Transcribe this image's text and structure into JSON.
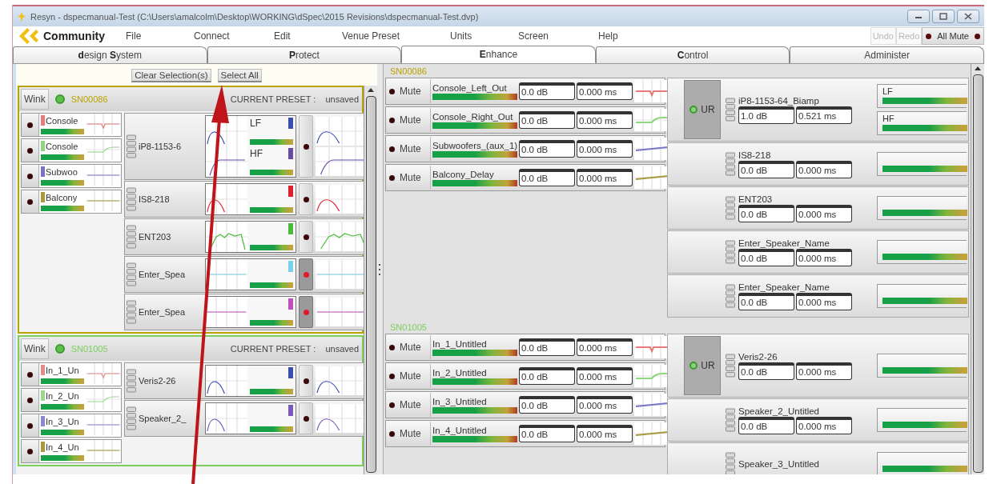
{
  "window": {
    "title": "Resyn - dspecmanual-Test (C:\\Users\\amalcolm\\Desktop\\WORKING\\dSpec\\2015 Revisions\\dspecmanual-Test.dvp)"
  },
  "menu": {
    "brand": "Community",
    "items": [
      "File",
      "Connect",
      "Edit",
      "Venue Preset",
      "Units",
      "Screen",
      "Help"
    ],
    "undo": {
      "label": "Undo",
      "disabled": true
    },
    "redo": {
      "label": "Redo",
      "disabled": true
    },
    "all_mute": "All Mute"
  },
  "tabs": [
    {
      "label": "**d**esign **S**ystem",
      "selected": false
    },
    {
      "label": "**P**rotect",
      "selected": false
    },
    {
      "label": "**E**nhance",
      "selected": true
    },
    {
      "label": "**C**ontrol",
      "selected": false
    },
    {
      "label": "Administer",
      "selected": false
    }
  ],
  "left_panel": {
    "clear_button": "Clear Selection(s)",
    "select_all_button": "Select All",
    "devices": [
      {
        "wink": "Wink",
        "serial": "SN00086",
        "color": "#b8a400",
        "preset_label": "CURRENT PRESET :",
        "preset_value": "unsaved",
        "inputs": [
          {
            "name": "Console",
            "color": "#e87a7a",
            "muted": false
          },
          {
            "name": "Console",
            "color": "#8fd47f",
            "muted": false
          },
          {
            "name": "Subwoo",
            "color": "#7a74c8",
            "muted": false
          },
          {
            "name": "Balcony",
            "color": "#a69a3a",
            "muted": false
          }
        ],
        "outputs": [
          {
            "name": "iP8-1153-6",
            "muted": false,
            "bands": [
              {
                "label": "LF",
                "color": "#3a4db0"
              },
              {
                "label": "HF",
                "color": "#6a4aa8"
              }
            ]
          },
          {
            "name": "IS8-218",
            "muted": false,
            "bands": [
              {
                "color": "#e02030"
              }
            ]
          },
          {
            "name": "ENT203",
            "muted": false,
            "bands": [
              {
                "color": "#4cba3c"
              }
            ]
          },
          {
            "name": "Enter_Spea",
            "muted": true,
            "bands": [
              {
                "color": "#7ad0e8"
              }
            ]
          },
          {
            "name": "Enter_Spea",
            "muted": true,
            "bands": [
              {
                "color": "#c050c0"
              }
            ]
          }
        ]
      },
      {
        "wink": "Wink",
        "serial": "SN01005",
        "color": "#7ccf5a",
        "preset_label": "CURRENT PRESET :",
        "preset_value": "unsaved",
        "inputs": [
          {
            "name": "In_1_Un",
            "color": "#e88a8a",
            "muted": false
          },
          {
            "name": "In_2_Un",
            "color": "#9ad88a",
            "muted": false
          },
          {
            "name": "In_3_Un",
            "color": "#8a86d8",
            "muted": false
          },
          {
            "name": "In_4_Un",
            "color": "#a69a3a",
            "muted": false
          }
        ],
        "outputs": [
          {
            "name": "Veris2-26",
            "muted": false,
            "bands": [
              {
                "color": "#3a4db0"
              }
            ]
          },
          {
            "name": "Speaker_2_",
            "muted": false,
            "bands": [
              {
                "color": "#7a5ab8"
              }
            ]
          }
        ]
      }
    ]
  },
  "right_panel": {
    "devices": [
      {
        "serial": "SN00086",
        "color": "#b8a400",
        "ur": "UR",
        "inputs": [
          {
            "mute": "Mute",
            "muted": false,
            "name": "Console_Left_Out",
            "gain": "0.0 dB",
            "delay": "0.000 ms",
            "color": "#e87a7a"
          },
          {
            "mute": "Mute",
            "muted": false,
            "name": "Console_Right_Out",
            "gain": "0.0 dB",
            "delay": "0.000 ms",
            "color": "#8fd47f"
          },
          {
            "mute": "Mute",
            "muted": false,
            "name": "Subwoofers_(aux_1)",
            "gain": "0.0 dB",
            "delay": "0.000 ms",
            "color": "#7a74c8"
          },
          {
            "mute": "Mute",
            "muted": false,
            "name": "Balcony_Delay",
            "gain": "0.0 dB",
            "delay": "0.000 ms",
            "color": "#a69a3a"
          }
        ],
        "outputs": [
          {
            "name": "iP8-1153-64_Biamp",
            "gain": "1.0 dB",
            "delay": "0.521 ms",
            "bands": [
              {
                "label": "LF"
              },
              {
                "label": "HF"
              }
            ]
          },
          {
            "name": "IS8-218",
            "gain": "0.0 dB",
            "delay": "0.000 ms"
          },
          {
            "name": "ENT203",
            "gain": "0.0 dB",
            "delay": "0.000 ms"
          },
          {
            "name": "Enter_Speaker_Name",
            "gain": "0.0 dB",
            "delay": "0.000 ms"
          },
          {
            "name": "Enter_Speaker_Name",
            "gain": "0.0 dB",
            "delay": "0.000 ms"
          }
        ]
      },
      {
        "serial": "SN01005",
        "color": "#7ccf5a",
        "ur": "UR",
        "inputs": [
          {
            "mute": "Mute",
            "muted": false,
            "name": "In_1_Untitled",
            "gain": "0.0 dB",
            "delay": "0.000 ms",
            "color": "#e87a7a"
          },
          {
            "mute": "Mute",
            "muted": false,
            "name": "In_2_Untitled",
            "gain": "0.0 dB",
            "delay": "0.000 ms",
            "color": "#8fd47f"
          },
          {
            "mute": "Mute",
            "muted": false,
            "name": "In_3_Untitled",
            "gain": "0.0 dB",
            "delay": "0.000 ms",
            "color": "#7a74c8"
          },
          {
            "mute": "Mute",
            "muted": false,
            "name": "In_4_Untitled",
            "gain": "0.0 dB",
            "delay": "0.000 ms",
            "color": "#a69a3a"
          }
        ],
        "outputs": [
          {
            "name": "Veris2-26",
            "gain": "0.0 dB",
            "delay": "0.000 ms"
          },
          {
            "name": "Speaker_2_Untitled",
            "gain": "0.0 dB",
            "delay": "0.000 ms"
          },
          {
            "name": "Speaker_3_Untitled"
          }
        ]
      }
    ]
  }
}
